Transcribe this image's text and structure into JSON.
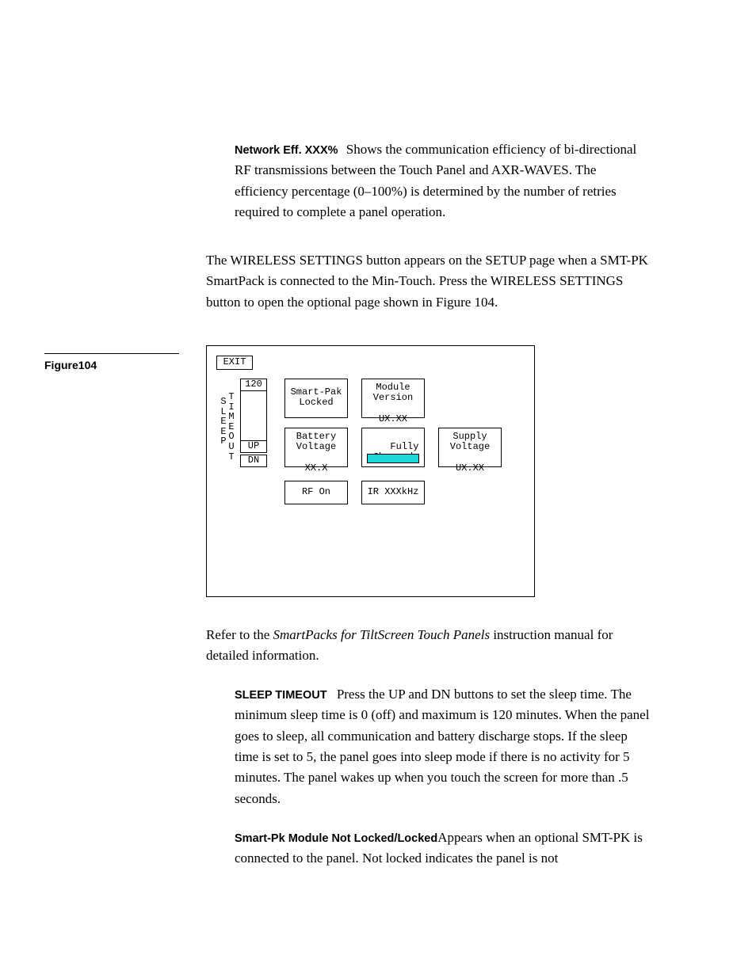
{
  "section1": {
    "heading": "Network Eff. XXX%",
    "body": "Shows the communication efficiency of bi-directional RF transmissions between the Touch Panel and AXR-WAVES. The efficiency percentage (0–100%) is determined by the number of retries required to complete a panel operation."
  },
  "para1": "The WIRELESS SETTINGS button appears on the SETUP page when a SMT-PK SmartPack is connected to the Min-Touch. Press the WIRELESS SETTINGS button to open the optional page shown in Figure 104.",
  "figure_label": "Figure104",
  "figure": {
    "exit": "EXIT",
    "sleep_value": "120",
    "sleep_label_left": "T\nI\nM\nE\nO\nU\nT",
    "sleep_label_left2": "S\nL\nE\nE\nP",
    "up": "UP",
    "dn": "DN",
    "smartpak": "Smart-Pak\nLocked",
    "battery": "Battery\nVoltage\n\nXX.X",
    "rf": "RF On",
    "module": "Module\nVersion\n\nUX.XX",
    "fully": "Fully\nCharged",
    "ir": "IR XXXkHz",
    "supply": "Supply\nVoltage\n\nUX.XX"
  },
  "para2_pre": "Refer to the ",
  "para2_em": "SmartPacks for TiltScreen Touch Panels",
  "para2_post": " instruction manual for detailed information.",
  "section2": {
    "heading": "SLEEP TIMEOUT",
    "body": "Press the UP and DN buttons to set the sleep time. The minimum sleep time is 0 (off) and maximum is 120 minutes. When the panel goes to sleep, all communication and battery discharge stops. If the sleep time is set to 5, the panel goes into sleep mode if there is no activity for 5 minutes. The panel wakes up when you touch the screen for more than .5 seconds."
  },
  "section3": {
    "heading": "Smart-Pk Module Not Locked/Locked",
    "body": "Appears when an optional SMT-PK is connected to the panel. Not locked indicates the panel is not"
  }
}
